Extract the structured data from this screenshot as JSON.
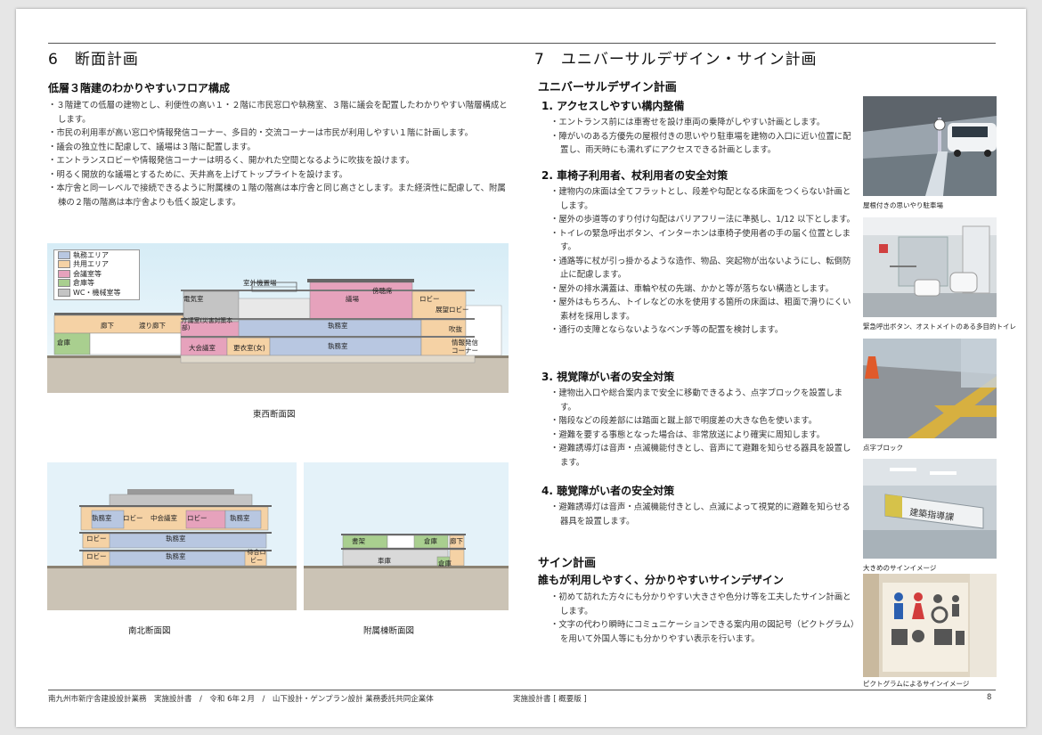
{
  "colors": {
    "office": "#b8c7e1",
    "common": "#f5d2a5",
    "meeting": "#e6a2bc",
    "storage": "#a9cf8f",
    "wc": "#c4c4c4",
    "sky": "#e6f3f9",
    "ground": "#c9c1b3"
  },
  "left": {
    "section_title": "6　断面計画",
    "subtitle": "低層３階建のわかりやすいフロア構成",
    "bullets": [
      "３階建ての低層の建物とし、利便性の高い１・２階に市民窓口や執務室、３階に議会を配置したわかりやすい階層構成とします。",
      "市民の利用率が高い窓口や情報発信コーナー、多目的・交流コーナーは市民が利用しやすい１階に計画します。",
      "議会の独立性に配慮して、議場は３階に配置します。",
      "エントランスロビーや情報発信コーナーは明るく、開かれた空間となるように吹抜を設けます。",
      "明るく開放的な議場とするために、天井高を上げてトップライトを設けます。",
      "本庁舎と同一レベルで接続できるように附属棟の１階の階高は本庁舎と同じ高さとします。また経済性に配慮して、附属棟の２階の階高は本庁舎よりも低く設定します。"
    ],
    "legend": [
      "執務エリア",
      "共用エリア",
      "会議室等",
      "倉庫等",
      "WC・機械室等"
    ],
    "ew_labels": {
      "outdoor_equip": "室外機置場",
      "machine": "電気室",
      "gallery": "傍聴席",
      "assembly": "議場",
      "lobby3": "ロビー",
      "obs_lobby": "展望ロビー",
      "corridor": "廊下",
      "walk_corridor": "渡り廊下",
      "disaster": "庁議室(災害対策本部)",
      "office2": "執務室",
      "atrium": "吹抜",
      "warehouse": "倉庫",
      "conference": "大会議室",
      "locker": "更衣室(女)",
      "office1": "執務室",
      "info": "情報発信コーナー"
    },
    "ns_labels": {
      "office3": "執務室",
      "lobby_a": "ロビー",
      "small_meet": "中会議室",
      "lobby_b": "ロビー",
      "office3b": "執務室",
      "lobby2": "ロビー",
      "office2": "執務室",
      "lobby1": "ロビー",
      "office1": "執務室",
      "wait": "待合ロビー"
    },
    "annex_labels": {
      "library": "書架",
      "storage": "倉庫",
      "corr": "廊下",
      "garage": "車庫",
      "store": "倉庫"
    },
    "captions": {
      "ew": "東西断面図",
      "ns": "南北断面図",
      "annex": "附属棟断面図"
    }
  },
  "right": {
    "section_title": "7　ユニバーサルデザイン・サイン計画",
    "ud_heading": "ユニバーサルデザイン計画",
    "groups": [
      {
        "title": "1. アクセスしやすい構内整備",
        "bullets": [
          "エントランス前には車寄せを設け車両の乗降がしやすい計画とします。",
          "障がいのある方優先の屋根付きの思いやり駐車場を建物の入口に近い位置に配置し、雨天時にも濡れずにアクセスできる計画とします。"
        ]
      },
      {
        "title": "2. 車椅子利用者、杖利用者の安全対策",
        "bullets": [
          "建物内の床面は全てフラットとし、段差や勾配となる床面をつくらない計画とします。",
          "屋外の歩道等のすり付け勾配はバリアフリー法に準拠し、1/12 以下とします。",
          "トイレの緊急呼出ボタン、インターホンは車椅子使用者の手の届く位置とします。",
          "通路等に杖が引っ掛かるような造作、物品、突起物が出ないようにし、転倒防止に配慮します。",
          "屋外の排水溝蓋は、車輪や杖の先端、かかと等が落ちない構造とします。",
          "屋外はもちろん、トイレなどの水を使用する箇所の床面は、粗面で滑りにくい素材を採用します。",
          "通行の支障とならないようなベンチ等の配置を検討します。"
        ]
      },
      {
        "title": "3. 視覚障がい者の安全対策",
        "bullets": [
          "建物出入口や総合案内まで安全に移動できるよう、点字ブロックを設置します。",
          "階段などの段差部には踏面と蹴上部で明度差の大きな色を使います。",
          "避難を要する事態となった場合は、非常放送により確実に周知します。",
          "避難誘導灯は音声・点滅機能付きとし、音声にて避難を知らせる器具を設置します。"
        ]
      },
      {
        "title": "4. 聴覚障がい者の安全対策",
        "bullets": [
          "避難誘導灯は音声・点滅機能付きとし、点滅によって視覚的に避難を知らせる器具を設置します。"
        ]
      }
    ],
    "sign_heading": "サイン計画",
    "sign_sub": "誰もが利用しやすく、分かりやすいサインデザイン",
    "sign_bullets": [
      "初めて訪れた方々にも分かりやすい大きさや色分け等を工夫したサイン計画とします。",
      "文字の代わり瞬時にコミュニケーションできる案内用の図記号（ピクトグラム）を用いて外国人等にも分かりやすい表示を行います。"
    ],
    "photos": [
      "屋根付きの思いやり駐車場",
      "緊急呼出ボタン、オストメイトのある多目的トイレ",
      "点字ブロック",
      "大きめのサインイメージ",
      "ピクトグラムによるサインイメージ"
    ],
    "sign_board_text": "建築指導課"
  },
  "footer": {
    "left": "南九州市新庁舎建設設計業務　実施設計書　/　令和 6年２月　/　山下設計・ゲンプラン設計 業務委託共同企業体",
    "center": "実施設計書 [ 概要版 ]",
    "page": "8"
  }
}
